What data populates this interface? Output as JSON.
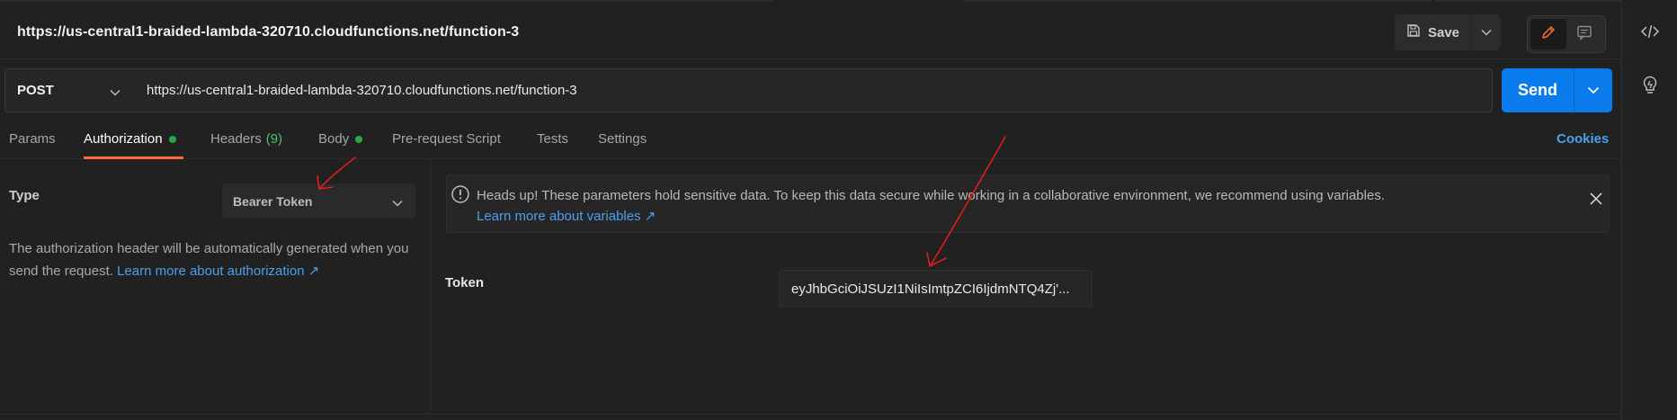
{
  "request": {
    "title": "https://us-central1-braided-lambda-320710.cloudfunctions.net/function-3",
    "method": "POST",
    "url": "https://us-central1-braided-lambda-320710.cloudfunctions.net/function-3"
  },
  "toolbar": {
    "save_label": "Save",
    "send_label": "Send"
  },
  "tabs": [
    {
      "label": "Params"
    },
    {
      "label": "Authorization",
      "active": true,
      "dot": true
    },
    {
      "label": "Headers",
      "count": "(9)"
    },
    {
      "label": "Body",
      "dot": true
    },
    {
      "label": "Pre-request Script"
    },
    {
      "label": "Tests"
    },
    {
      "label": "Settings"
    }
  ],
  "cookies_label": "Cookies",
  "auth": {
    "type_label": "Type",
    "type_value": "Bearer Token",
    "description": "The authorization header will be automatically generated when you send the request.",
    "learn_more_auth": "Learn more about authorization ↗",
    "alert_text": "Heads up! These parameters hold sensitive data. To keep this data secure while working in a collaborative environment, we recommend using variables.",
    "alert_link": "Learn more about variables ↗",
    "token_label": "Token",
    "token_value": "eyJhbGciOiJSUzI1NiIsImtpZCI6IjdmNTQ4Zj'..."
  },
  "colors": {
    "accent_send": "#097bed",
    "tab_underline": "#ff6c37",
    "status_dot": "#2ba84a",
    "link": "#4d9ff0",
    "annotation": "#e21b1b"
  },
  "icons": {
    "save": "floppy-disk-icon",
    "edit": "pencil-icon",
    "comment": "comment-icon",
    "code": "code-icon",
    "lightbulb": "lightbulb-icon",
    "info": "info-circle-icon",
    "close": "close-icon"
  }
}
